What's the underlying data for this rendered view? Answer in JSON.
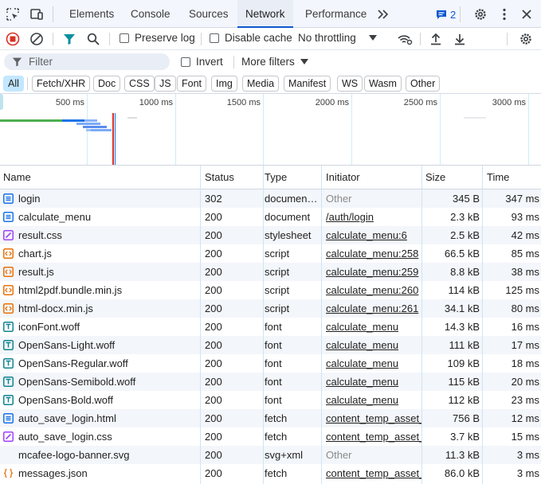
{
  "tabbar": {
    "tabs": [
      "Elements",
      "Console",
      "Sources",
      "Network",
      "Performance"
    ],
    "active_tab": "Network",
    "issues_count": "2"
  },
  "toolbar": {
    "preserve_log": "Preserve log",
    "disable_cache": "Disable cache",
    "throttling": "No throttling"
  },
  "filter": {
    "placeholder": "Filter",
    "invert": "Invert",
    "more_filters": "More filters"
  },
  "type_filters": [
    "All",
    "Fetch/XHR",
    "Doc",
    "CSS",
    "JS",
    "Font",
    "Img",
    "Media",
    "Manifest",
    "WS",
    "Wasm",
    "Other"
  ],
  "overview": {
    "ticks": [
      "500 ms",
      "1000 ms",
      "1500 ms",
      "2000 ms",
      "2500 ms",
      "3000 ms"
    ]
  },
  "table": {
    "columns": [
      "Name",
      "Status",
      "Type",
      "Initiator",
      "Size",
      "Time"
    ],
    "rows": [
      {
        "name": "login",
        "status": "302",
        "type": "documen…",
        "initiator": "Other",
        "size": "345 B",
        "time": "347 ms",
        "icon": "document-icon"
      },
      {
        "name": "calculate_menu",
        "status": "200",
        "type": "document",
        "initiator": "/auth/login",
        "size": "2.3 kB",
        "time": "93 ms",
        "icon": "document-icon"
      },
      {
        "name": "result.css",
        "status": "200",
        "type": "stylesheet",
        "initiator": "calculate_menu:6",
        "size": "2.5 kB",
        "time": "42 ms",
        "icon": "stylesheet-icon"
      },
      {
        "name": "chart.js",
        "status": "200",
        "type": "script",
        "initiator": "calculate_menu:258",
        "size": "66.5 kB",
        "time": "85 ms",
        "icon": "script-icon"
      },
      {
        "name": "result.js",
        "status": "200",
        "type": "script",
        "initiator": "calculate_menu:259",
        "size": "8.8 kB",
        "time": "38 ms",
        "icon": "script-icon"
      },
      {
        "name": "html2pdf.bundle.min.js",
        "status": "200",
        "type": "script",
        "initiator": "calculate_menu:260",
        "size": "114 kB",
        "time": "125 ms",
        "icon": "script-icon"
      },
      {
        "name": "html-docx.min.js",
        "status": "200",
        "type": "script",
        "initiator": "calculate_menu:261",
        "size": "34.1 kB",
        "time": "80 ms",
        "icon": "script-icon"
      },
      {
        "name": "iconFont.woff",
        "status": "200",
        "type": "font",
        "initiator": "calculate_menu",
        "size": "14.3 kB",
        "time": "16 ms",
        "icon": "font-icon"
      },
      {
        "name": "OpenSans-Light.woff",
        "status": "200",
        "type": "font",
        "initiator": "calculate_menu",
        "size": "111 kB",
        "time": "17 ms",
        "icon": "font-icon"
      },
      {
        "name": "OpenSans-Regular.woff",
        "status": "200",
        "type": "font",
        "initiator": "calculate_menu",
        "size": "109 kB",
        "time": "18 ms",
        "icon": "font-icon"
      },
      {
        "name": "OpenSans-Semibold.woff",
        "status": "200",
        "type": "font",
        "initiator": "calculate_menu",
        "size": "115 kB",
        "time": "20 ms",
        "icon": "font-icon"
      },
      {
        "name": "OpenSans-Bold.woff",
        "status": "200",
        "type": "font",
        "initiator": "calculate_menu",
        "size": "112 kB",
        "time": "23 ms",
        "icon": "font-icon"
      },
      {
        "name": "auto_save_login.html",
        "status": "200",
        "type": "fetch",
        "initiator": "content_temp_asset_",
        "size": "756 B",
        "time": "12 ms",
        "icon": "document-icon"
      },
      {
        "name": "auto_save_login.css",
        "status": "200",
        "type": "fetch",
        "initiator": "content_temp_asset_",
        "size": "3.7 kB",
        "time": "15 ms",
        "icon": "stylesheet-icon"
      },
      {
        "name": "mcafee-logo-banner.svg",
        "status": "200",
        "type": "svg+xml",
        "initiator": "Other",
        "size": "11.3 kB",
        "time": "3 ms",
        "icon": "image-icon"
      },
      {
        "name": "messages.json",
        "status": "200",
        "type": "fetch",
        "initiator": "content_temp_asset_",
        "size": "86.0 kB",
        "time": "3 ms",
        "icon": "json-icon"
      }
    ]
  }
}
